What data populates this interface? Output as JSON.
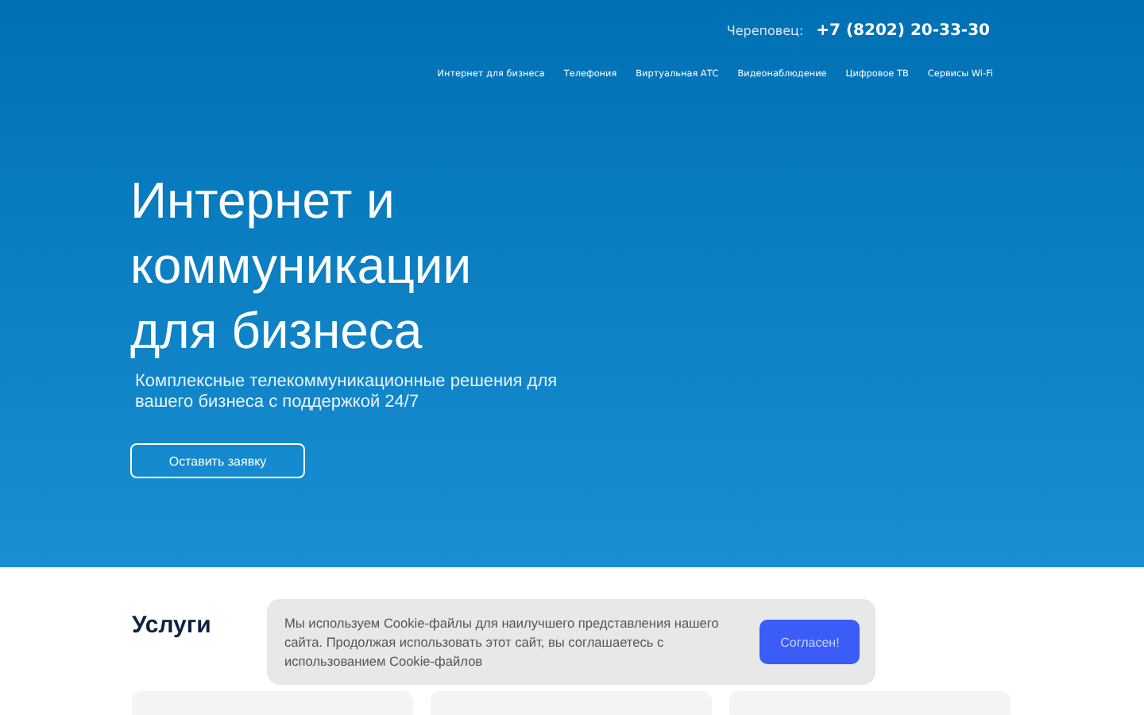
{
  "header": {
    "city": "Череповец:",
    "phone": "+7 (8202) 20-33-30"
  },
  "nav": [
    "Интернет для бизнеса",
    "Телефония",
    "Виртуальная АТС",
    "Видеонаблюдение",
    "Цифровое ТВ",
    "Сервисы Wi-Fi"
  ],
  "hero": {
    "title_lines": [
      "Интернет и",
      "коммуникации",
      "для бизнеса"
    ],
    "subtitle": "Комплексные телекоммуникационные решения для вашего бизнеса с поддержкой 24/7",
    "button": "Оставить заявку"
  },
  "services": {
    "title": "Услуги"
  },
  "cookie": {
    "text": "Мы используем Cookie-файлы для наилучшего представления нашего сайта. Продолжая использовать этот сайт, вы соглашаетесь с использованием Cookie-файлов",
    "button": "Согласен!"
  }
}
